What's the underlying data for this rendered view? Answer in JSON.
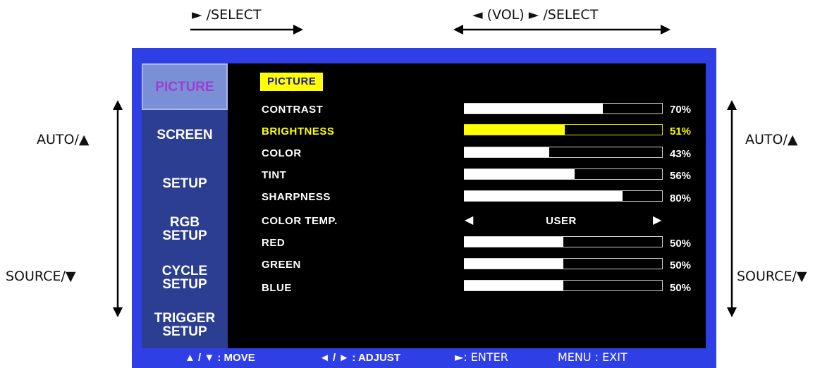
{
  "annotations": {
    "top_left": "► /SELECT",
    "top_right": "◄  (VOL)   ► /SELECT",
    "left_auto": "AUTO/▲",
    "left_source": "SOURCE/▼",
    "right_auto": "AUTO/▲",
    "right_source": "SOURCE/▼"
  },
  "sidebar": {
    "items": [
      {
        "line1": "PICTURE",
        "line2": "",
        "active": true
      },
      {
        "line1": "SCREEN",
        "line2": ""
      },
      {
        "line1": "SETUP",
        "line2": ""
      },
      {
        "line1": "RGB",
        "line2": "SETUP"
      },
      {
        "line1": "CYCLE",
        "line2": "SETUP"
      },
      {
        "line1": "TRIGGER",
        "line2": "SETUP"
      }
    ]
  },
  "panel": {
    "title": "PICTURE",
    "rows": [
      {
        "label": "CONTRAST",
        "value": 70,
        "value_text": "70%"
      },
      {
        "label": "BRIGHTNESS",
        "value": 51,
        "value_text": "51%",
        "highlighted": true
      },
      {
        "label": "COLOR",
        "value": 43,
        "value_text": "43%"
      },
      {
        "label": "TINT",
        "value": 56,
        "value_text": "56%"
      },
      {
        "label": "SHARPNESS",
        "value": 80,
        "value_text": "80%"
      },
      {
        "label": "COLOR TEMP.",
        "selector": true,
        "value_text": "USER"
      },
      {
        "label": "RED",
        "value": 50,
        "value_text": "50%"
      },
      {
        "label": "GREEN",
        "value": 50,
        "value_text": "50%"
      },
      {
        "label": "BLUE",
        "value": 50,
        "value_text": "50%"
      }
    ]
  },
  "footer": {
    "move": "▲ / ▼ : MOVE",
    "adjust": "◄ / ► : ADJUST",
    "enter": "►: ENTER",
    "exit": "MENU : EXIT"
  },
  "colors": {
    "frame": "#2f3fe6",
    "sidebar": "#2c3e92",
    "highlight": "#ffff00",
    "active_tab_text": "#9a3fd0"
  }
}
